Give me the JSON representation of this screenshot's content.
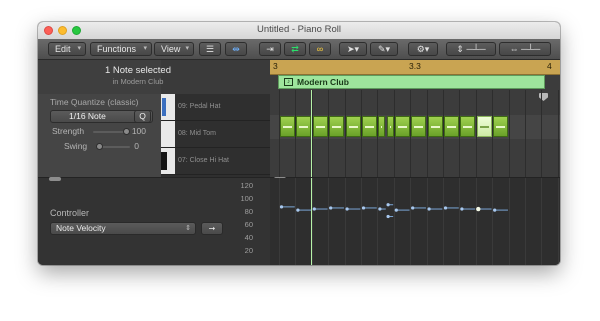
{
  "window": {
    "title": "Untitled - Piano Roll"
  },
  "toolbar": {
    "edit_label": "Edit",
    "functions_label": "Functions",
    "view_label": "View",
    "caret": "▾",
    "list_icon": "list-view-icon",
    "catch_icon": "catch-playhead-icon",
    "midi_in_icon": "midi-in-icon",
    "midi_out_icon": "midi-out-icon",
    "link_icon": "link-icon",
    "pointer_tool": "pointer-tool-icon",
    "pencil_tool": "pencil-tool-icon",
    "settings_icon": "gear-icon",
    "vertical_zoom": "vertical-zoom-slider",
    "horizontal_zoom": "horizontal-zoom-slider"
  },
  "inspector": {
    "selection_title": "1 Note selected",
    "selection_subtitle": "in Modern Club",
    "time_quantize_label": "Time Quantize (classic)",
    "quantize_value": "1/16 Note",
    "q_label": "Q",
    "strength_label": "Strength",
    "strength_value": "100",
    "strength_level": 1.0,
    "swing_label": "Swing",
    "swing_value": "0",
    "swing_level": 0.0
  },
  "keys": [
    {
      "label": "09: Pedal Hat"
    },
    {
      "label": "08: Mid Tom"
    },
    {
      "label": "07: Close Hi Hat"
    }
  ],
  "ruler": {
    "bar_start": "3",
    "bar_mid": "3.3",
    "bar_end": "4"
  },
  "region": {
    "name": "Modern Club"
  },
  "notes": [
    {
      "start": 0.0,
      "length": 0.9
    },
    {
      "start": 1.0,
      "length": 0.9
    },
    {
      "start": 2.0,
      "length": 0.9
    },
    {
      "start": 3.0,
      "length": 0.9
    },
    {
      "start": 4.0,
      "length": 0.9
    },
    {
      "start": 5.0,
      "length": 0.9
    },
    {
      "start": 6.0,
      "length": 0.45
    },
    {
      "start": 6.5,
      "length": 0.4
    },
    {
      "start": 7.0,
      "length": 0.9
    },
    {
      "start": 8.0,
      "length": 0.9
    },
    {
      "start": 9.0,
      "length": 0.9
    },
    {
      "start": 10.0,
      "length": 0.9
    },
    {
      "start": 11.0,
      "length": 0.9
    },
    {
      "start": 12.0,
      "length": 0.9,
      "selected": true
    },
    {
      "start": 13.0,
      "length": 0.9
    }
  ],
  "controller": {
    "label": "Controller",
    "selected": "Note Velocity",
    "y_ticks": [
      "120",
      "100",
      "80",
      "60",
      "40",
      "20"
    ],
    "velocities": [
      {
        "start": 0.0,
        "length": 0.9,
        "v": 88
      },
      {
        "start": 1.0,
        "length": 0.9,
        "v": 82
      },
      {
        "start": 2.0,
        "length": 0.9,
        "v": 84
      },
      {
        "start": 3.0,
        "length": 0.9,
        "v": 86
      },
      {
        "start": 4.0,
        "length": 0.9,
        "v": 84
      },
      {
        "start": 5.0,
        "length": 0.9,
        "v": 86
      },
      {
        "start": 6.0,
        "length": 0.45,
        "v": 84
      },
      {
        "start": 6.5,
        "length": 0.4,
        "v": 92
      },
      {
        "start": 6.5,
        "length": 0.4,
        "v": 70
      },
      {
        "start": 7.0,
        "length": 0.9,
        "v": 82
      },
      {
        "start": 8.0,
        "length": 0.9,
        "v": 86
      },
      {
        "start": 9.0,
        "length": 0.9,
        "v": 84
      },
      {
        "start": 10.0,
        "length": 0.9,
        "v": 86
      },
      {
        "start": 11.0,
        "length": 0.9,
        "v": 84
      },
      {
        "start": 12.0,
        "length": 0.9,
        "v": 84,
        "selected": true
      },
      {
        "start": 13.0,
        "length": 0.9,
        "v": 82
      }
    ]
  },
  "colors": {
    "note": "#8cc63f",
    "note_selected": "#e6f7cc",
    "region": "#9ee59c",
    "ruler": "#c9a452",
    "velocity_line": "#7aa6d6"
  }
}
